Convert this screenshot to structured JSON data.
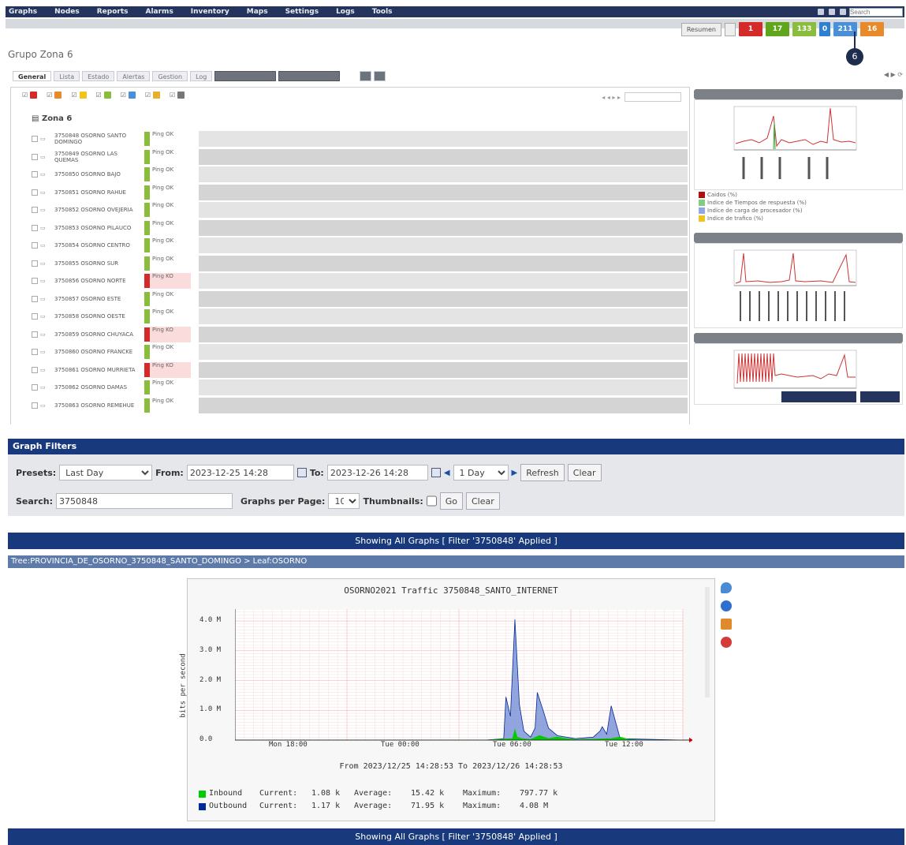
{
  "topnav": {
    "items": [
      "Graphs",
      "Nodes",
      "Reports",
      "Alarms",
      "Inventory",
      "Maps",
      "Settings",
      "Logs",
      "Tools"
    ],
    "search_placeholder": "Search"
  },
  "page_title": "Grupo Zona 6",
  "tabs": [
    "General",
    "Lista",
    "Estado",
    "Alertas",
    "Gestion",
    "Log"
  ],
  "zone_label": "Zona 6",
  "header_buttons": {
    "cb_label": "Resumen"
  },
  "status_badges": [
    {
      "label": "1",
      "color": "#d42a2a"
    },
    {
      "label": "17",
      "color": "#5fa61a"
    },
    {
      "label": "133",
      "color": "#8bbd3c"
    },
    {
      "label": "0",
      "color": "#2c7fd2"
    },
    {
      "label": "211",
      "color": "#4a90d8"
    },
    {
      "label": "16",
      "color": "#e8892a"
    }
  ],
  "side_legend": [
    {
      "label": "Caidos (%)",
      "color": "#b11010"
    },
    {
      "label": "Indice de Tiempos de respuesta (%)",
      "color": "#7fcf7f"
    },
    {
      "label": "Indice de carga de procesador (%)",
      "color": "#8fa6e8"
    },
    {
      "label": "Indice de trafico (%)",
      "color": "#f0c419"
    }
  ],
  "graph_filters": {
    "title": "Graph Filters",
    "presets_label": "Presets:",
    "presets_value": "Last Day",
    "from_label": "From:",
    "from_value": "2023-12-25 14:28",
    "to_label": "To:",
    "to_value": "2023-12-26 14:28",
    "span_value": "1 Day",
    "refresh": "Refresh",
    "clear": "Clear",
    "search_label": "Search:",
    "search_value": "3750848",
    "gpp_label": "Graphs per Page:",
    "gpp_value": "10",
    "thumbnails_label": "Thumbnails:",
    "go": "Go",
    "clear2": "Clear"
  },
  "showing_text": "Showing All Graphs [ Filter '3750848' Applied ]",
  "tree_text": "Tree:PROVINCIA_DE_OSORNO_3750848_SANTO_DOMINGO > Leaf:OSORNO",
  "graph": {
    "title": "OSORNO2021 Traffic 3750848_SANTO_INTERNET",
    "ylabel": "bits per second",
    "from_to": "From 2023/12/25 14:28:53 To 2023/12/26 14:28:53",
    "inbound": {
      "name": "Inbound",
      "current": "Current:",
      "cur_val": "1.08 k",
      "average": "Average:",
      "avg_val": "15.42 k",
      "maximum": "Maximum:",
      "max_val": "797.77 k",
      "color": "#00cc00"
    },
    "outbound": {
      "name": "Outbound",
      "current": "Current:",
      "cur_val": "1.17 k",
      "average": "Average:",
      "avg_val": "71.95 k",
      "maximum": "Maximum:",
      "max_val": "4.08 M",
      "color": "#002a97"
    }
  },
  "chart_data": {
    "type": "area",
    "title": "OSORNO2021 Traffic 3750848_SANTO_INTERNET",
    "xlabel": "",
    "ylabel": "bits per second",
    "yticks": [
      "0.0",
      "1.0 M",
      "2.0 M",
      "3.0 M",
      "4.0 M"
    ],
    "xticks": [
      "Mon 18:00",
      "Tue 00:00",
      "Tue 06:00",
      "Tue 12:00"
    ],
    "ylim": [
      0,
      4.4
    ],
    "series": [
      {
        "name": "Inbound",
        "color": "#00cc00",
        "x": [
          0,
          0.56,
          0.62,
          0.625,
          0.63,
          0.64,
          0.66,
          0.68,
          0.7,
          0.72,
          0.74,
          0.76,
          0.8,
          0.84,
          0.86,
          0.88,
          0.9,
          1
        ],
        "values": [
          0,
          0,
          0.05,
          0.35,
          0.1,
          0.05,
          0.02,
          0.15,
          0.05,
          0.1,
          0.05,
          0.02,
          0.03,
          0.05,
          0.1,
          0.02,
          0.01,
          0
        ]
      },
      {
        "name": "Outbound",
        "color": "#002a97",
        "x": [
          0,
          0.56,
          0.6,
          0.605,
          0.615,
          0.625,
          0.635,
          0.645,
          0.66,
          0.67,
          0.675,
          0.69,
          0.7,
          0.72,
          0.74,
          0.76,
          0.8,
          0.815,
          0.82,
          0.83,
          0.84,
          0.86,
          1
        ],
        "values": [
          0,
          0,
          0.05,
          1.45,
          0.8,
          4.05,
          1.2,
          0.3,
          0.1,
          0.4,
          1.6,
          0.9,
          0.4,
          0.15,
          0.1,
          0.05,
          0.1,
          0.3,
          0.45,
          0.2,
          1.15,
          0.05,
          0
        ]
      }
    ]
  },
  "device_rows": [
    {
      "name": "3750848 OSORNO SANTO DOMINGO",
      "status": "green",
      "val": "Ping OK"
    },
    {
      "name": "3750849 OSORNO LAS QUEMAS",
      "status": "green",
      "val": "Ping OK"
    },
    {
      "name": "3750850 OSORNO BAJO",
      "status": "green",
      "val": "Ping OK"
    },
    {
      "name": "3750851 OSORNO RAHUE",
      "status": "green",
      "val": "Ping OK"
    },
    {
      "name": "3750852 OSORNO OVEJERIA",
      "status": "green",
      "val": "Ping OK"
    },
    {
      "name": "3750853 OSORNO PILAUCO",
      "status": "green",
      "val": "Ping OK"
    },
    {
      "name": "3750854 OSORNO CENTRO",
      "status": "green",
      "val": "Ping OK"
    },
    {
      "name": "3750855 OSORNO SUR",
      "status": "green",
      "val": "Ping OK"
    },
    {
      "name": "3750856 OSORNO NORTE",
      "status": "red",
      "val": "Ping KO"
    },
    {
      "name": "3750857 OSORNO ESTE",
      "status": "green",
      "val": "Ping OK"
    },
    {
      "name": "3750858 OSORNO OESTE",
      "status": "green",
      "val": "Ping OK"
    },
    {
      "name": "3750859 OSORNO CHUYACA",
      "status": "red",
      "val": "Ping KO"
    },
    {
      "name": "3750860 OSORNO FRANCKE",
      "status": "green",
      "val": "Ping OK"
    },
    {
      "name": "3750861 OSORNO MURRIETA",
      "status": "red",
      "val": "Ping KO"
    },
    {
      "name": "3750862 OSORNO DAMAS",
      "status": "green",
      "val": "Ping OK"
    },
    {
      "name": "3750863 OSORNO REMEHUE",
      "status": "green",
      "val": "Ping OK"
    }
  ]
}
